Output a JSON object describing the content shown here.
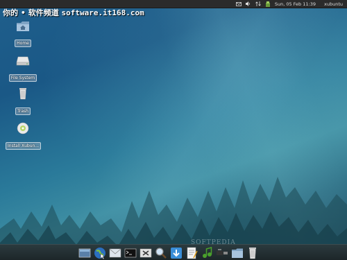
{
  "watermark": {
    "chinese": "你的 • 软件频道",
    "domain": "software.it168.com"
  },
  "top_panel": {
    "datetime": "Sun, 05 Feb  11:39",
    "user": "xubuntu",
    "tray_icons": [
      "mail-icon",
      "volume-icon",
      "network-icon",
      "updates-icon"
    ]
  },
  "desktop_icons": [
    {
      "label": "Home",
      "icon": "home-folder-icon"
    },
    {
      "label": "File System",
      "icon": "drive-icon"
    },
    {
      "label": "Trash",
      "icon": "trash-icon"
    },
    {
      "label": "Install Xubun...",
      "icon": "cd-icon"
    }
  ],
  "dock_icons": [
    "show-desktop-icon",
    "web-browser-icon",
    "mail-client-icon",
    "terminal-icon",
    "settings-icon",
    "search-icon",
    "download-icon",
    "text-editor-icon",
    "media-player-icon",
    "network-tools-icon",
    "file-manager-icon",
    "trash-icon"
  ],
  "softpedia_watermark": "SOFTPEDIA"
}
